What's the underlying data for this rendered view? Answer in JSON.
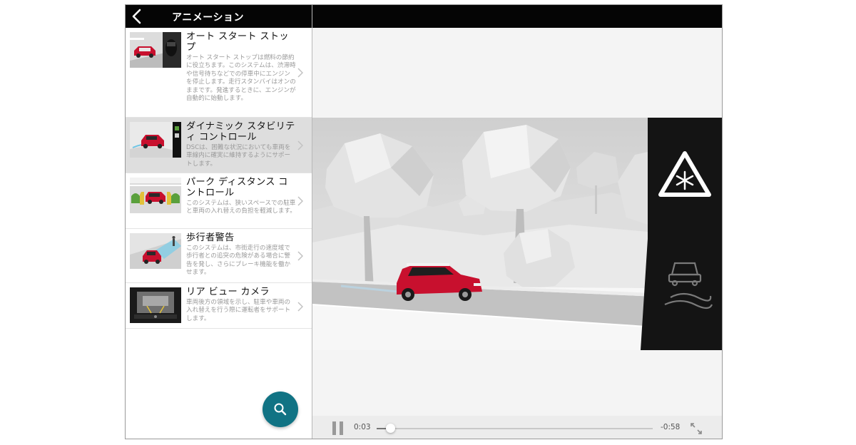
{
  "header": {
    "title": "アニメーション"
  },
  "items": [
    {
      "title": "オート スタート ストップ",
      "desc": "オート スタート ストップは燃料の節約に役立ちます。このシステムは、渋滞時や信号待ちなどでの停車中にエンジンを停止します。走行スタンバイはオンのままです。発進するときに、エンジンが自動的に始動します。"
    },
    {
      "title": "ダイナミック スタビリティ コントロール",
      "desc": "DSCは、困難な状況においても車両を車線内に確実に維持するようにサポートします。"
    },
    {
      "title": "パーク ディスタンス コントロール",
      "desc": "このシステムは、狭いスペースでの駐車と車両の入れ替えの負担を軽減します。"
    },
    {
      "title": "歩行者警告",
      "desc": "このシステムは、市街走行の速度域で歩行者との追突の危険がある場合に警告を発し、さらにブレーキ機能を働かせます。"
    },
    {
      "title": "リア ビュー カメラ",
      "desc": "車両後方の領域を示し、駐車や車両の入れ替えを行う際に運転者をサポートします。"
    }
  ],
  "player": {
    "elapsed": "0:03",
    "remaining": "-0:58",
    "progress": 0.05
  },
  "colors": {
    "accent": "#117384",
    "header": "#050505",
    "selected_row": "#dedede",
    "car": "#c8102e"
  },
  "icons": {
    "back": "chevron-left-icon",
    "search": "search-icon",
    "pause": "pause-icon",
    "expand": "expand-icon",
    "row": "chevron-right-icon",
    "warning": "snow-warning-icon",
    "skid": "car-skid-icon"
  }
}
